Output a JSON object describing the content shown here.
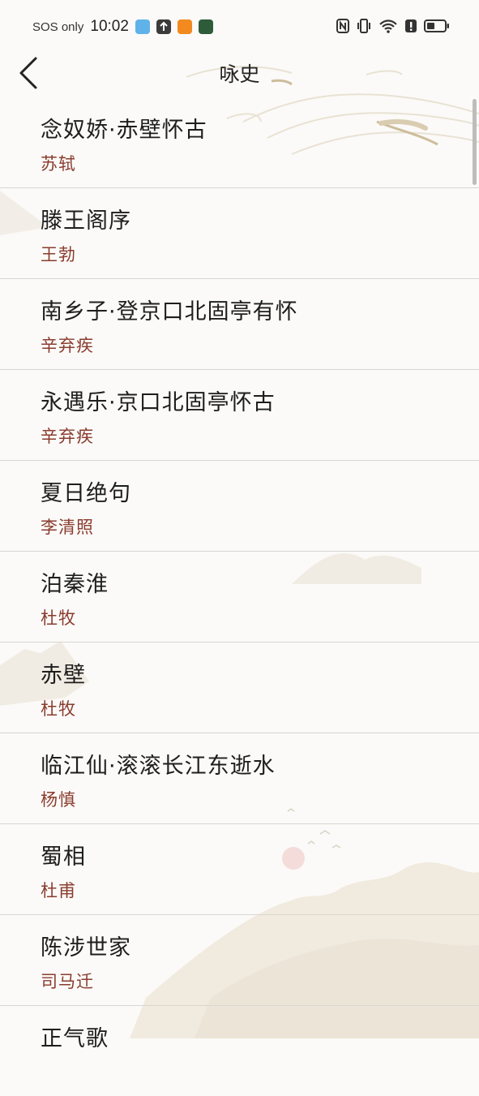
{
  "status_bar": {
    "sos": "SOS only",
    "time": "10:02",
    "app_icons": [
      "weather-app-icon",
      "upload-icon",
      "novel-app-icon",
      "game-app-icon"
    ],
    "right_icons": [
      "nfc-icon",
      "vibrate-icon",
      "wifi-icon",
      "alert-icon",
      "battery-icon"
    ]
  },
  "header": {
    "title": "咏史",
    "back_icon": "chevron-left-icon"
  },
  "poems": [
    {
      "title": "念奴娇·赤壁怀古",
      "author": "苏轼"
    },
    {
      "title": "滕王阁序",
      "author": "王勃"
    },
    {
      "title": "南乡子·登京口北固亭有怀",
      "author": "辛弃疾"
    },
    {
      "title": "永遇乐·京口北固亭怀古",
      "author": "辛弃疾"
    },
    {
      "title": "夏日绝句",
      "author": "李清照"
    },
    {
      "title": "泊秦淮",
      "author": "杜牧"
    },
    {
      "title": "赤壁",
      "author": "杜牧"
    },
    {
      "title": "临江仙·滚滚长江东逝水",
      "author": "杨慎"
    },
    {
      "title": "蜀相",
      "author": "杜甫"
    },
    {
      "title": "陈涉世家",
      "author": "司马迁"
    },
    {
      "title": "正气歌",
      "author": ""
    }
  ],
  "colors": {
    "author": "#8a3c2e",
    "title": "#1e1e1e",
    "divider": "#d8d6d2",
    "background": "#fbfaf8"
  }
}
